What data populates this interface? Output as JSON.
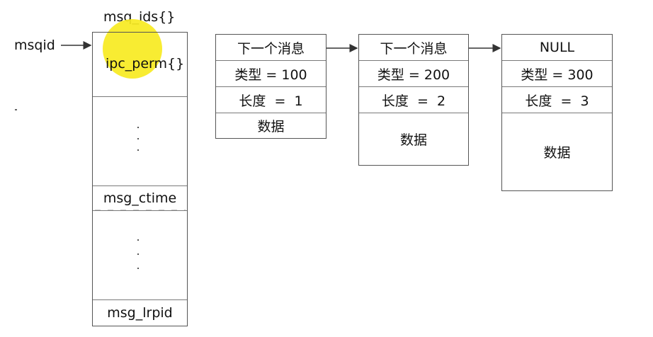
{
  "struct": {
    "title": "msq_ids{}",
    "pointer_label": "msqid",
    "perm_label": "ipc_perm{}",
    "ctime_label": "msg_ctime",
    "lrpid_label": "msg_lrpid"
  },
  "messages": [
    {
      "next": "下一个消息",
      "type": "类型 = 100",
      "length": "长度  =  1",
      "data": "数据"
    },
    {
      "next": "下一个消息",
      "type": "类型 = 200",
      "length": "长度  =  2",
      "data": "数据"
    },
    {
      "next": "NULL",
      "type": "类型 = 300",
      "length": "长度  =  3",
      "data": "数据"
    }
  ],
  "colors": {
    "highlight": "#f7ea21",
    "border": "#555555",
    "text": "#111111"
  }
}
